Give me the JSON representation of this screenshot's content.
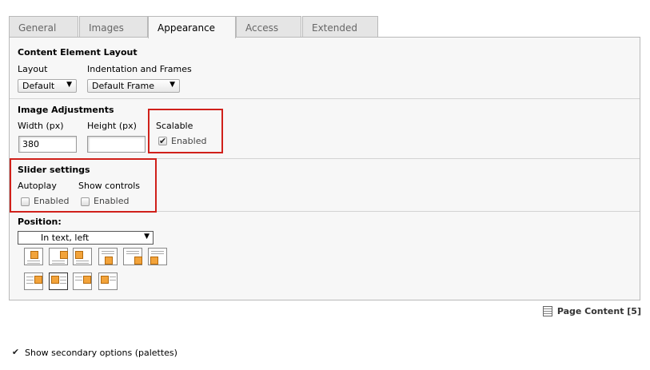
{
  "tabs": [
    "General",
    "Images",
    "Appearance",
    "Access",
    "Extended"
  ],
  "active_tab": "Appearance",
  "content_layout": {
    "title": "Content Element Layout",
    "layout_label": "Layout",
    "layout_value": "Default",
    "frame_label": "Indentation and Frames",
    "frame_value": "Default Frame"
  },
  "image_adjustments": {
    "title": "Image Adjustments",
    "width_label": "Width (px)",
    "width_value": "380",
    "height_label": "Height (px)",
    "height_value": "",
    "scalable_label": "Scalable",
    "scalable_checkbox_label": "Enabled",
    "scalable_checked": true
  },
  "slider_settings": {
    "title": "Slider settings",
    "autoplay_label": "Autoplay",
    "autoplay_checkbox_label": "Enabled",
    "autoplay_checked": false,
    "controls_label": "Show controls",
    "controls_checkbox_label": "Enabled",
    "controls_checked": false
  },
  "position": {
    "title": "Position:",
    "value": "In text, left",
    "icons": [
      "position-center-top-icon",
      "position-right-top-icon",
      "position-left-top-icon",
      "position-center-bottom-icon",
      "position-right-bottom-icon",
      "position-left-bottom-icon",
      "position-text-right-icon",
      "position-text-left-icon",
      "position-text-right-nowrap-icon",
      "position-text-left-nowrap-icon"
    ]
  },
  "footer": {
    "page_content_label": "Page Content [5]",
    "secondary_options_label": "Show secondary options (palettes)",
    "secondary_options_checked": true
  },
  "colors": {
    "highlight_border": "#d0201a",
    "panel_bg": "#f7f7f7",
    "tab_bg": "#e5e5e5",
    "icon_square": "#f2a33a"
  }
}
